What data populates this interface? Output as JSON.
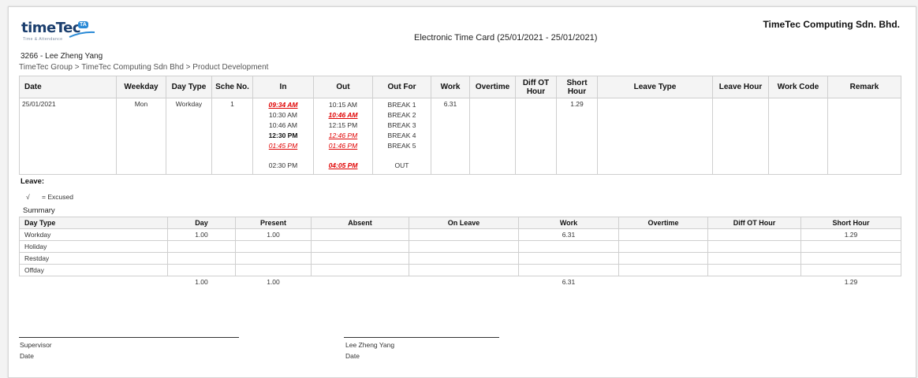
{
  "header": {
    "logo_text_1": "time",
    "logo_text_2": "Tec",
    "logo_badge": "TA",
    "logo_tagline": "Time & Attendance",
    "company": "TimeTec Computing Sdn. Bhd.",
    "title": "Electronic Time Card  (25/01/2021 - 25/01/2021)",
    "employee": "3266 - Lee Zheng Yang",
    "breadcrumb": "TimeTec Group > TimeTec Computing Sdn Bhd > Product Development"
  },
  "timecard": {
    "columns": [
      "Date",
      "Weekday",
      "Day Type",
      "Sche No.",
      "In",
      "Out",
      "Out For",
      "Work",
      "Overtime",
      "Diff OT Hour",
      "Short Hour",
      "Leave Type",
      "Leave Hour",
      "Work Code",
      "Remark"
    ],
    "row": {
      "date": "25/01/2021",
      "weekday": "Mon",
      "day_type": "Workday",
      "sche_no": "1",
      "in": [
        "09:34 AM",
        "10:30 AM",
        "10:46 AM",
        "12:30 PM",
        "01:45 PM",
        "02:30 PM"
      ],
      "out": [
        "10:15 AM",
        "10:46 AM",
        "12:15 PM",
        "12:46 PM",
        "01:46 PM",
        "04:05 PM"
      ],
      "out_for": [
        "BREAK 1",
        "BREAK 2",
        "BREAK 3",
        "BREAK 4",
        "BREAK 5",
        "OUT"
      ],
      "work": "6.31",
      "short_hour": "1.29"
    }
  },
  "leave": {
    "title": "Leave:",
    "legend_mark": "√",
    "legend_text": "= Excused"
  },
  "summary": {
    "title": "Summary",
    "columns": [
      "Day Type",
      "Day",
      "Present",
      "Absent",
      "On Leave",
      "Work",
      "Overtime",
      "Diff OT Hour",
      "Short Hour"
    ],
    "rows": [
      [
        "Workday",
        "1.00",
        "1.00",
        "",
        "",
        "6.31",
        "",
        "",
        "1.29"
      ],
      [
        "Holiday",
        "",
        "",
        "",
        "",
        "",
        "",
        "",
        ""
      ],
      [
        "Restday",
        "",
        "",
        "",
        "",
        "",
        "",
        "",
        ""
      ],
      [
        "Offday",
        "",
        "",
        "",
        "",
        "",
        "",
        "",
        ""
      ]
    ],
    "total": [
      "",
      "1.00",
      "1.00",
      "",
      "",
      "6.31",
      "",
      "",
      "1.29"
    ]
  },
  "signatures": {
    "left_role": "Supervisor",
    "left_date": "Date",
    "right_name": "Lee Zheng Yang",
    "right_date": "Date"
  }
}
